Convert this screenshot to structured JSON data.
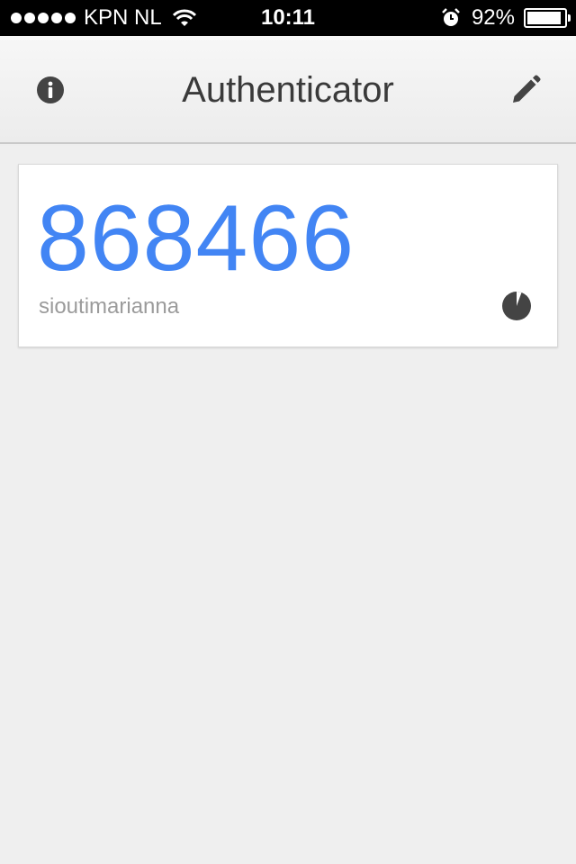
{
  "status_bar": {
    "carrier": "KPN NL",
    "time": "10:11",
    "battery_percent": "92%",
    "battery_level": 0.92
  },
  "header": {
    "title": "Authenticator",
    "info_icon": "info-icon",
    "edit_icon": "pencil-icon"
  },
  "accounts": [
    {
      "code": "868466",
      "name": "sioutimarianna",
      "timer_icon": "countdown-pie-icon"
    }
  ],
  "colors": {
    "code": "#4285f4",
    "icon": "#444444",
    "account_label": "#9b9b9b"
  }
}
